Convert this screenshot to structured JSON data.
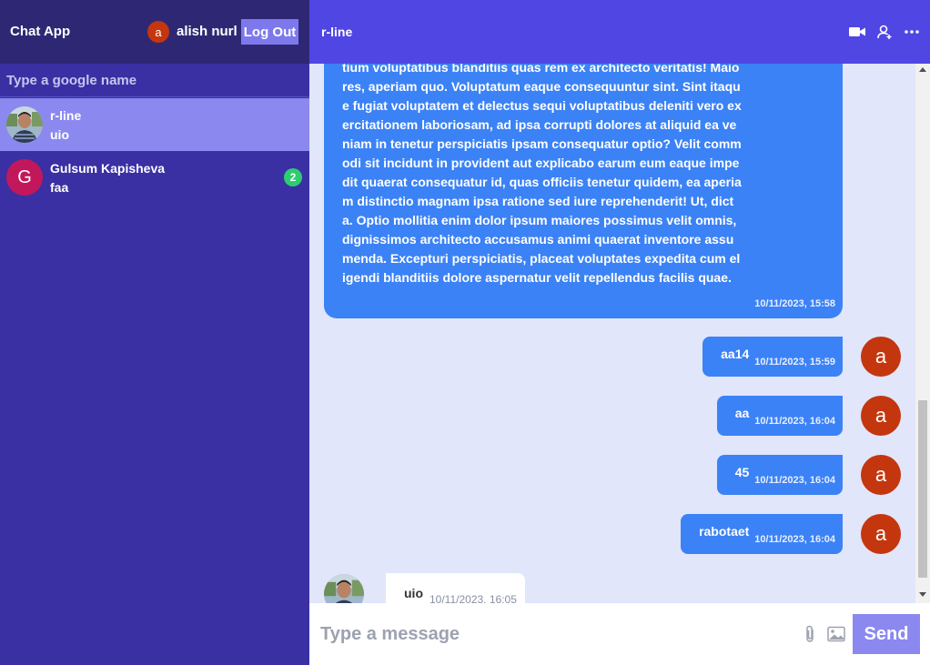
{
  "sidebar": {
    "app_title": "Chat App",
    "user": {
      "avatar_letter": "a",
      "name": "alish nurl"
    },
    "logout_label": "Log Out",
    "search_placeholder": "Type a google name",
    "contacts": [
      {
        "name": "r-line",
        "last_message": "uio",
        "avatar": "photo",
        "active": true
      },
      {
        "name": "Gulsum Kapisheva",
        "last_message": "faa",
        "avatar_letter": "G",
        "avatar_color": "#c2185b",
        "unread": "2"
      }
    ]
  },
  "chat": {
    "title": "r-line",
    "header_icons": [
      "video-icon",
      "add-user-icon",
      "more-icon"
    ],
    "messages": [
      {
        "text": "tium voluptatibus blanditiis quas rem ex architecto veritatis! Maiores, aperiam quo. Voluptatum eaque consequuntur sint. Sint itaque fugiat voluptatem et delectus sequi voluptatibus deleniti vero exercitationem laboriosam, ad ipsa corrupti dolores at aliquid ea veniam in tenetur perspiciatis ipsam consequatur optio? Velit commodi sit incidunt in provident aut explicabo earum eum eaque impedit quaerat consequatur id, quas officiis tenetur quidem, ea aperiam distinctio magnam ipsa ratione sed iure reprehenderit! Ut, dicta. Optio mollitia enim dolor ipsum maiores possimus velit omnis, dignissimos architecto accusamus animi quaerat inventore assumenda. Excepturi perspiciatis, placeat voluptates expedita cum eligendi blanditiis dolore aspernatur velit repellendus facilis quae.",
        "time": "10/11/2023, 15:58",
        "sender": "me"
      },
      {
        "text": "aa14",
        "time": "10/11/2023, 15:59",
        "sender": "me",
        "avatar_letter": "a"
      },
      {
        "text": "aa",
        "time": "10/11/2023, 16:04",
        "sender": "me",
        "avatar_letter": "a"
      },
      {
        "text": "45",
        "time": "10/11/2023, 16:04",
        "sender": "me",
        "avatar_letter": "a"
      },
      {
        "text": "rabotaet",
        "time": "10/11/2023, 16:04",
        "sender": "me",
        "avatar_letter": "a"
      },
      {
        "text": "uio",
        "time": "10/11/2023, 16:05",
        "sender": "r-line"
      }
    ]
  },
  "composer": {
    "placeholder": "Type a message",
    "send_label": "Send",
    "icons": [
      "paperclip-icon",
      "image-icon"
    ]
  },
  "colors": {
    "sidebar_bg": "#3a30a3",
    "sidebar_header_bg": "#2e2874",
    "chat_header_bg": "#5046e4",
    "accent": "#8b88f0",
    "bubble_blue": "#3b82f6",
    "user_avatar": "#c4360e",
    "badge_green": "#2ecc71"
  }
}
